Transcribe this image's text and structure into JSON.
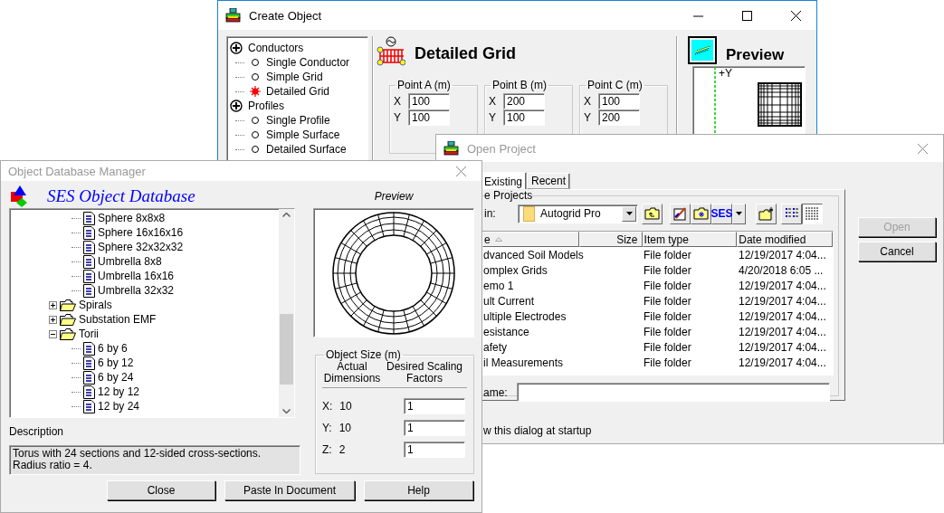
{
  "create_object": {
    "title": "Create Object",
    "active": true,
    "tree": [
      {
        "label": "Conductors",
        "children": [
          {
            "label": "Single Conductor",
            "selected": false
          },
          {
            "label": "Simple Grid",
            "selected": false
          },
          {
            "label": "Detailed Grid",
            "selected": true
          }
        ]
      },
      {
        "label": "Profiles",
        "children": [
          {
            "label": "Single Profile",
            "selected": false
          },
          {
            "label": "Simple Surface",
            "selected": false
          },
          {
            "label": "Detailed Surface",
            "selected": false
          }
        ]
      }
    ],
    "heading": "Detailed Grid",
    "points": [
      {
        "label": "Point A (m)",
        "fields": [
          {
            "axis": "X",
            "value": "100"
          },
          {
            "axis": "Y",
            "value": "100"
          }
        ]
      },
      {
        "label": "Point B (m)",
        "fields": [
          {
            "axis": "X",
            "value": "200"
          },
          {
            "axis": "Y",
            "value": "100"
          }
        ]
      },
      {
        "label": "Point C (m)",
        "fields": [
          {
            "axis": "X",
            "value": "100"
          },
          {
            "axis": "Y",
            "value": "200"
          }
        ]
      }
    ],
    "preview": {
      "label": "Preview",
      "axis_label": "+Y"
    }
  },
  "open_project": {
    "title": "Open Project",
    "active": false,
    "tabs": [
      {
        "label": "Existing",
        "selected": true
      },
      {
        "label": "Recent",
        "selected": false
      }
    ],
    "group_label": "e Projects",
    "look_in": {
      "label": "in:",
      "value": "Autogrid Pro"
    },
    "toolbar_text": "SES",
    "view_modes": [
      {
        "selected": false
      },
      {
        "selected": true
      }
    ],
    "columns": [
      "e",
      "Size",
      "Item type",
      "Date modified"
    ],
    "rows": [
      {
        "name": "dvanced Soil Models",
        "type": "File folder",
        "date": "12/19/2017 4:04..."
      },
      {
        "name": "omplex Grids",
        "type": "File folder",
        "date": "4/20/2018 6:05 ..."
      },
      {
        "name": "emo 1",
        "type": "File folder",
        "date": "12/19/2017 4:04..."
      },
      {
        "name": "ult Current",
        "type": "File folder",
        "date": "12/19/2017 4:04..."
      },
      {
        "name": "ultiple Electrodes",
        "type": "File folder",
        "date": "12/19/2017 4:04..."
      },
      {
        "name": "esistance",
        "type": "File folder",
        "date": "12/19/2017 4:04..."
      },
      {
        "name": "afety",
        "type": "File folder",
        "date": "12/19/2017 4:04..."
      },
      {
        "name": "il Measurements",
        "type": "File folder",
        "date": "12/19/2017 4:04..."
      }
    ],
    "file_name_label": "ame:",
    "startup_text": "w this dialog at startup",
    "buttons": [
      {
        "label": "Open",
        "disabled": true
      },
      {
        "label": "Cancel",
        "disabled": false
      }
    ]
  },
  "object_database": {
    "title": "Object Database Manager",
    "active": false,
    "heading": "SES Object Database",
    "preview_label": "Preview",
    "tree": {
      "continued_items": [
        "Sphere 8x8x8",
        "Sphere 16x16x16",
        "Sphere 32x32x32",
        "Umbrella 8x8",
        "Umbrella 16x16",
        "Umbrella 32x32"
      ],
      "folders": [
        {
          "label": "Spirals",
          "expanded": false
        },
        {
          "label": "Substation EMF",
          "expanded": false
        },
        {
          "label": "Torii",
          "expanded": true,
          "children": [
            "6 by 6",
            "6 by 12",
            "6 by 24",
            "12 by 12",
            "12 by 24"
          ]
        }
      ]
    },
    "size": {
      "label": "Object Size (m)",
      "actual_heading": "Actual Dimensions",
      "factor_heading": "Desired Scaling Factors",
      "rows": [
        {
          "axis": "X:",
          "actual": "10",
          "factor": "1"
        },
        {
          "axis": "Y:",
          "actual": "10",
          "factor": "1"
        },
        {
          "axis": "Z:",
          "actual": "2",
          "factor": "1"
        }
      ]
    },
    "description_label": "Description",
    "description": "Torus with 24 sections and 12-sided cross-sections.\nRadius ratio = 4.",
    "buttons": [
      "Close",
      "Paste In Document",
      "Help"
    ]
  }
}
